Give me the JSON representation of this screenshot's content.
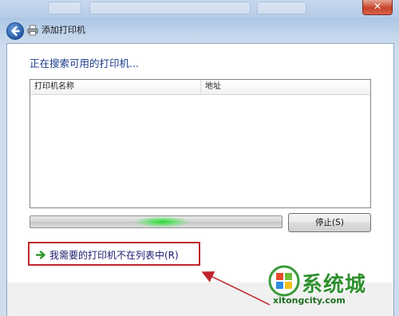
{
  "window": {
    "title": "添加打印机",
    "close_label": "✕"
  },
  "main": {
    "status_text": "正在搜索可用的打印机...",
    "columns": [
      "打印机名称",
      "地址"
    ],
    "progress": {
      "indeterminate": true,
      "glow_color": "#2ad235"
    },
    "stop_button": "停止(S)",
    "not_in_list_link": "我需要的打印机不在列表中(R)"
  },
  "annotation": {
    "box_color": "#c0262c",
    "arrow_color": "#c0262c"
  },
  "watermark": {
    "logo_text": "系统城",
    "url_text": "xitongcity.com"
  }
}
